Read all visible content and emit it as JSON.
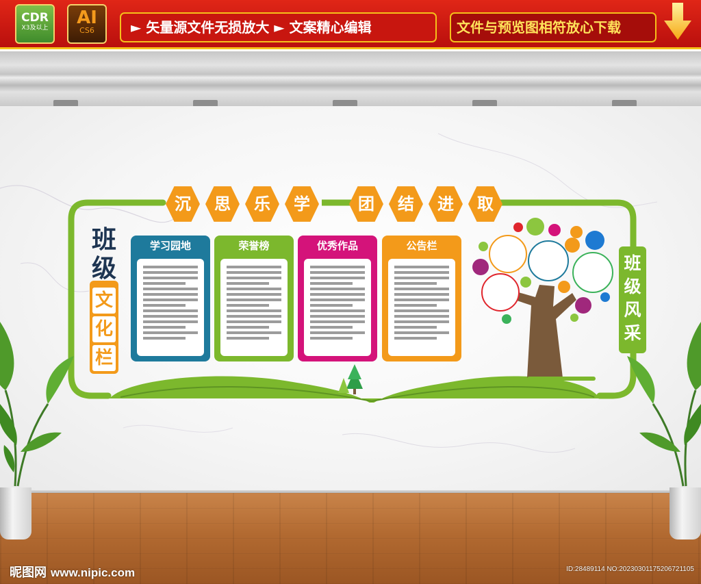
{
  "banner": {
    "cdr_badge": {
      "label": "CDR",
      "sub": "X3及以上",
      "color": "#5aa63a"
    },
    "ai_badge": {
      "label": "AI",
      "sub": "CS6",
      "color": "#f49a1c"
    },
    "features": "► 矢量源文件无损放大 ► 文案精心编辑",
    "download_note": "文件与预览图相符放心下载",
    "arrow_icon": "down-arrow-icon",
    "colors": {
      "background": "#c8160f",
      "border": "#f5c11a",
      "download_text": "#ffe25a"
    }
  },
  "board": {
    "slogan": [
      "沉",
      "思",
      "乐",
      "学",
      "团",
      "结",
      "进",
      "取"
    ],
    "left_title_dark": [
      "班",
      "级"
    ],
    "left_title_box": [
      "文",
      "化",
      "栏"
    ],
    "right_title": [
      "班",
      "级",
      "风",
      "采"
    ],
    "panels": [
      {
        "title": "学习园地",
        "color": "#1e7a9c"
      },
      {
        "title": "荣誉榜",
        "color": "#7cb82d"
      },
      {
        "title": "优秀作品",
        "color": "#d4137a"
      },
      {
        "title": "公告栏",
        "color": "#f39a1a"
      }
    ],
    "colors": {
      "frame": "#7cb82d",
      "accent": "#f39a1a",
      "dark_text": "#1e3552",
      "trunk": "#7a5a3b"
    },
    "decoration_icons": [
      "pine-tree-icon",
      "photo-tree-icon",
      "open-book-icon"
    ]
  },
  "watermark": {
    "logo": "昵图网",
    "url": "www.nipic.com",
    "image_id": "ID:28489114 NO:20230301175206721105"
  }
}
